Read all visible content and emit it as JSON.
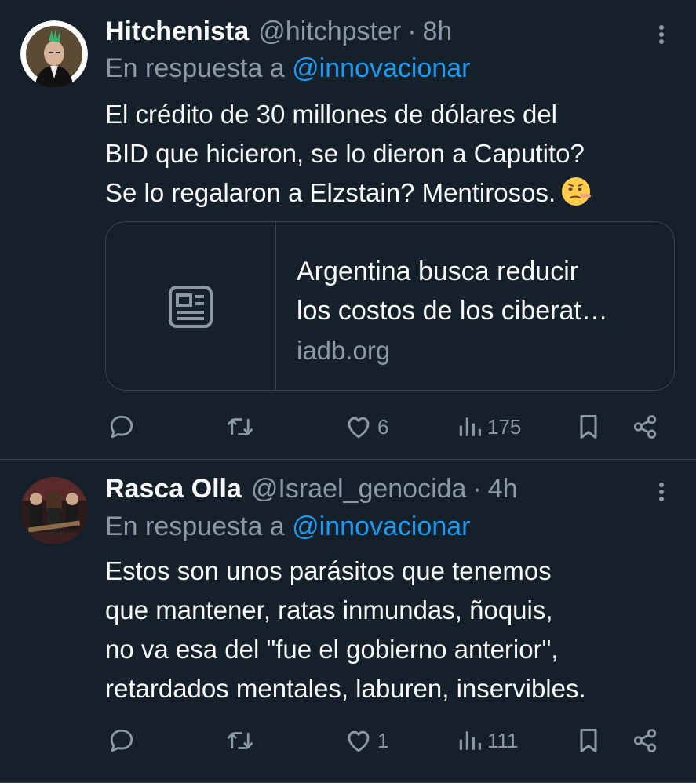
{
  "colors": {
    "background": "#15202b",
    "text_primary": "#f7f9f9",
    "text_secondary": "#8b98a5",
    "accent": "#1d9bf0",
    "border": "#38444d"
  },
  "tweets": [
    {
      "author_name": "Hitchenista",
      "handle": "@hitchpster",
      "separator": "·",
      "time": "8h",
      "reply_prefix": "En respuesta a",
      "reply_mention": "@innovacionar",
      "text_lines": [
        "El crédito de 30 millones de dólares del",
        "BID que hicieron, se lo dieron a Caputito?",
        "Se lo regalaron a Elzstain? Mentirosos."
      ],
      "emoji": "lying-face-emoji",
      "link_card": {
        "title_lines": [
          "Argentina busca reducir",
          "los costos de los ciberat…"
        ],
        "domain": "iadb.org",
        "icon": "article-icon"
      },
      "actions": {
        "reply_icon": "reply-icon",
        "retweet_icon": "retweet-icon",
        "like_icon": "like-icon",
        "likes": "6",
        "views_icon": "views-icon",
        "views": "175",
        "bookmark_icon": "bookmark-icon",
        "share_icon": "share-icon"
      }
    },
    {
      "author_name": "Rasca Olla",
      "handle": "@Israel_genocida",
      "separator": "·",
      "time": "4h",
      "reply_prefix": "En respuesta a",
      "reply_mention": "@innovacionar",
      "text_lines": [
        "Estos son unos parásitos que tenemos",
        "que mantener, ratas inmundas, ñoquis,",
        "no va esa del \"fue el gobierno anterior\",",
        "retardados mentales, laburen, inservibles."
      ],
      "actions": {
        "reply_icon": "reply-icon",
        "retweet_icon": "retweet-icon",
        "like_icon": "like-icon",
        "likes": "1",
        "views_icon": "views-icon",
        "views": "111",
        "bookmark_icon": "bookmark-icon",
        "share_icon": "share-icon"
      }
    }
  ]
}
